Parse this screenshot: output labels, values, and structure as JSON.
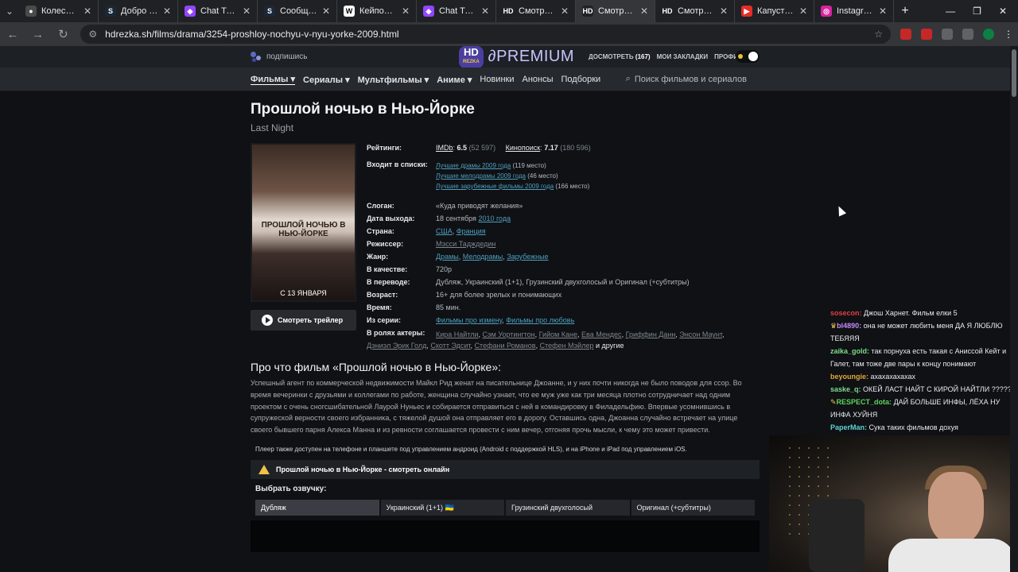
{
  "browser": {
    "tabs": [
      {
        "title": "Колесо случайны",
        "color": "#4a4a4a",
        "glyph": "●"
      },
      {
        "title": "Добро пожалова",
        "color": "#1b2838",
        "glyph": "S"
      },
      {
        "title": "Chat Tracker",
        "color": "#9147ff",
        "glyph": "◆"
      },
      {
        "title": "Сообщество Ste",
        "color": "#1b2838",
        "glyph": "S"
      },
      {
        "title": "Кейпоп-охотниц",
        "color": "#ffffff",
        "glyph": "W"
      },
      {
        "title": "Chat Tracker",
        "color": "#9147ff",
        "glyph": "◆"
      },
      {
        "title": "Смотреть фильм",
        "color": "#202124",
        "glyph": "HD"
      },
      {
        "title": "Смотреть фильм",
        "color": "#202124",
        "glyph": "HD"
      },
      {
        "title": "Смотреть фильм",
        "color": "#202124",
        "glyph": "HD"
      },
      {
        "title": "Капустная Дол",
        "color": "#e52d27",
        "glyph": "▶"
      },
      {
        "title": "Instagram",
        "color": "#d6249f",
        "glyph": "◎"
      }
    ],
    "new_tab": "+",
    "url": "hdrezka.sh/films/drama/3254-proshloy-nochyu-v-nyu-yorke-2009.html"
  },
  "site": {
    "subscribe": "подпишись",
    "logo_hd": "HD",
    "logo_rezka": "REZKA",
    "logo_premium": "PREMIUM",
    "watch_later": "ДОСМОТРЕТЬ",
    "watch_later_count": "(167)",
    "bookmarks": "МОИ ЗАКЛАДКИ",
    "profile": "ПРОФИЛЬ",
    "nav": {
      "films": "Фильмы",
      "series": "Сериалы",
      "cartoons": "Мультфильмы",
      "anime": "Аниме",
      "new": "Новинки",
      "announces": "Анонсы",
      "collections": "Подборки",
      "search_placeholder": "Поиск фильмов и сериалов"
    }
  },
  "movie": {
    "title": "Прошлой ночью в Нью-Йорке",
    "original": "Last Night",
    "poster_title": "ПРОШЛОЙ НОЧЬЮ В НЬЮ-ЙОРКЕ",
    "poster_date": "С 13 ЯНВАРЯ",
    "trailer": "Смотреть трейлер",
    "labels": {
      "ratings": "Рейтинги:",
      "lists": "Входит в списки:",
      "slogan": "Слоган:",
      "release": "Дата выхода:",
      "country": "Страна:",
      "director": "Режиссер:",
      "genre": "Жанр:",
      "quality": "В качестве:",
      "translation": "В переводе:",
      "age": "Возраст:",
      "time": "Время:",
      "series": "Из серии:",
      "actors": "В ролях актеры:"
    },
    "imdb_label": "IMDb",
    "imdb_rating": "6.5",
    "imdb_votes": "(52 597)",
    "kp_label": "Кинопоиск",
    "kp_rating": "7.17",
    "kp_votes": "(180 596)",
    "lists": [
      {
        "name": "Лучшие драмы 2009 года",
        "place": "(119 место)"
      },
      {
        "name": "Лучшие мелодрамы 2009 года",
        "place": "(46 место)"
      },
      {
        "name": "Лучшие зарубежные фильмы 2009 года",
        "place": "(166 место)"
      }
    ],
    "slogan": "«Куда приводят желания»",
    "release_day": "18 сентября",
    "release_year": "2010 года",
    "country_1": "США",
    "country_2": "Франция",
    "director": "Мэсси Тадждедин",
    "genre_1": "Драмы",
    "genre_2": "Мелодрамы",
    "genre_3": "Зарубежные",
    "quality": "720p",
    "translation": "Дубляж, Украинский (1+1), Грузинский двухголосый и Оригинал (+субтитры)",
    "age": "16+ для более зрелых и понимающих",
    "time": "85 мин.",
    "series_1": "Фильмы про измену",
    "series_2": "Фильмы про любовь",
    "actors": [
      "Кира Найтли",
      "Сэм Уортингтон",
      "Гийом Кане",
      "Ева Мендес",
      "Гриффин Данн",
      "Энсон Маунт",
      "Дэниэл Эрик Голд",
      "Скотт Эдсит",
      "Стефани Романов",
      "Стефен Мэйлер"
    ],
    "actors_more": "и другие",
    "about_heading": "Про что фильм «Прошлой ночью в Нью-Йорке»:",
    "about_text": "Успешный агент по коммерческой недвижимости Майкл Рид женат на писательнице Джоанне, и у них почти никогда не было поводов для ссор. Во время вечеринки с друзьями и коллегами по работе, женщина случайно узнает, что ее муж уже как три месяца плотно сотрудничает над одним проектом с очень сногсшибательной Лаурой Нуньес и собирается отправиться с ней в командировку в Филадельфию. Впервые усомнившись в супружеской верности своего избранника, с тяжелой душой она отправляет его в дорогу. Оставшись одна, Джоанна случайно встречает на улице своего бывшего парня Алекса Манна и из ревности соглашается провести с ним вечер, отгоняя прочь мысли, к чему это может привести.",
    "player_note": "Плеер также доступен на телефоне и планшете под управлением андроид (Android с поддержкой HLS), и на iPhone и iPad под управлением iOS.",
    "watch_bar": "Прошлой ночью в Нью-Йорке - смотреть онлайн",
    "voice_heading": "Выбрать озвучку:",
    "voices": [
      "Дубляж",
      "Украинский (1+1) 🇺🇦",
      "Грузинский двухголосый",
      "Оригинал (+субтитры)"
    ]
  },
  "chat": [
    {
      "name": "sosecon:",
      "color": "#e04040",
      "text": " Джош Харнет. Фильм елки 5"
    },
    {
      "name": "bl4890:",
      "color": "#c58af9",
      "text": " она не может любить меня ДА Я ЛЮБЛЮ ТЕБЯЯЯ",
      "badge": "♛"
    },
    {
      "name": "zaika_gold:",
      "color": "#7ddc8b",
      "text": " так порнуха есть такая с Аниссой Кейт и Галет, там тоже две пары к концу понимают"
    },
    {
      "name": "beyoungie:",
      "color": "#e0a83e",
      "text": " ахахахахахах"
    },
    {
      "name": "saske_q:",
      "color": "#7ddc8b",
      "text": " ОКЕЙ ЛАСТ НАЙТ С КИРОЙ НАЙТЛИ ?????"
    },
    {
      "name": "RESPECT_dota:",
      "color": "#5fd35f",
      "text": " ДАЙ БОЛЬШЕ ИНФЫ, ЛЁХА НУ ИНФА ХУЙНЯ",
      "badge": "✎"
    },
    {
      "name": "PaperMan:",
      "color": "#5fd3d3",
      "text": " Сука таких фильмов дохуя"
    }
  ]
}
